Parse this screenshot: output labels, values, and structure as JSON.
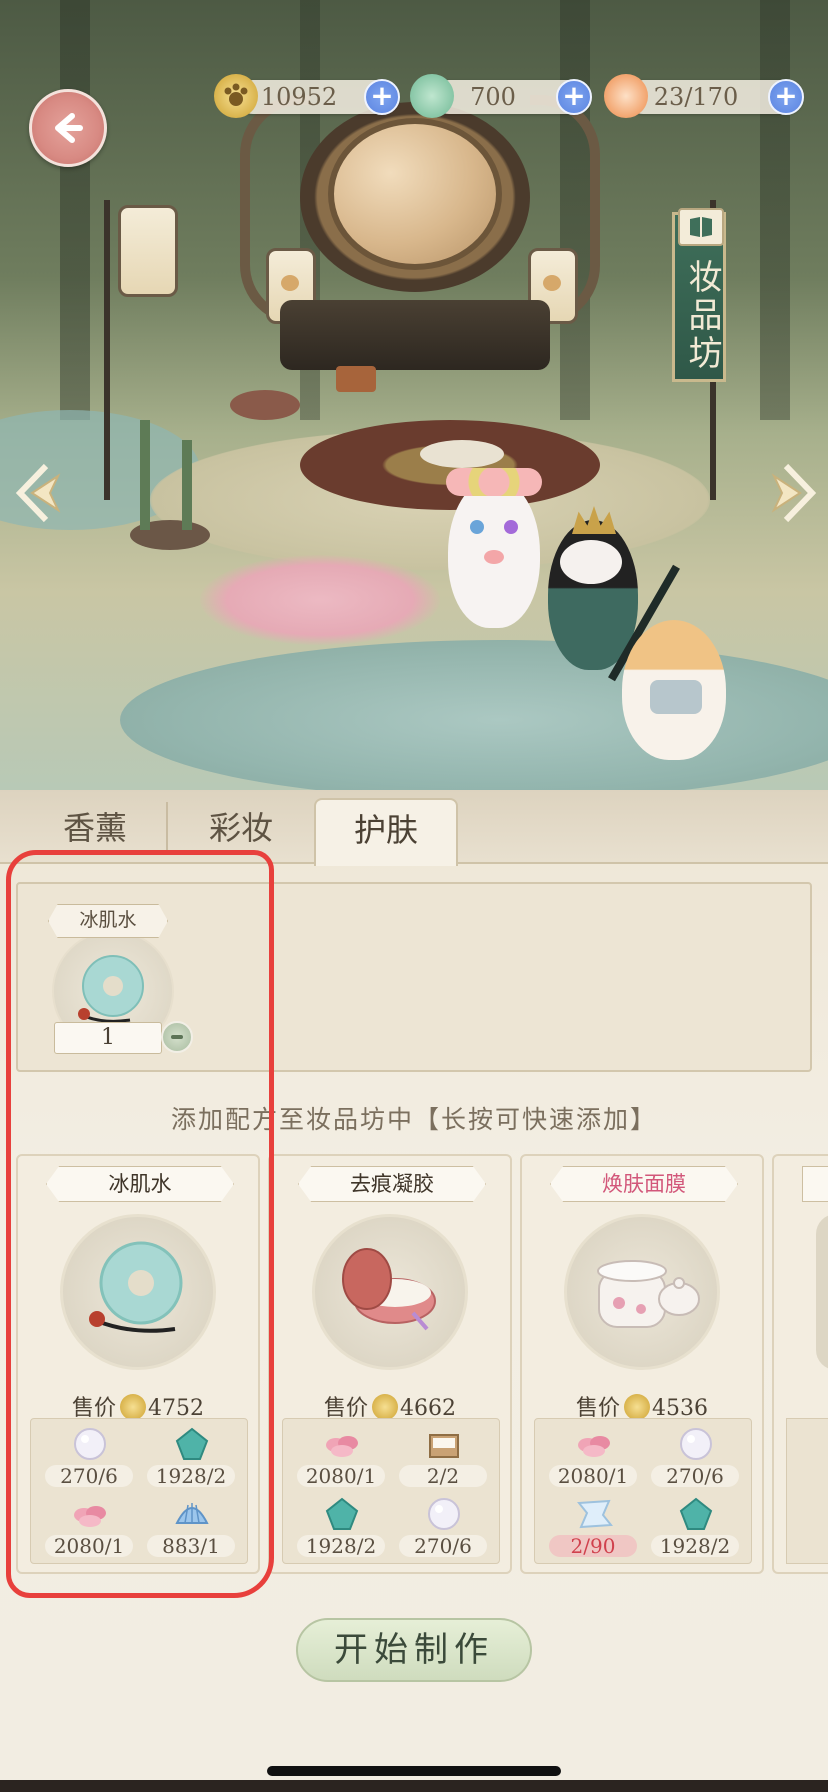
{
  "resources": [
    {
      "icon": "paw-coin-icon",
      "value": "10952"
    },
    {
      "icon": "jade-cicada-icon",
      "value": "700"
    },
    {
      "icon": "peach-bun-icon",
      "value": "23/170"
    }
  ],
  "sign": {
    "text": "妆品坊"
  },
  "tabs": [
    {
      "label": "香薰",
      "active": false
    },
    {
      "label": "彩妆",
      "active": false
    },
    {
      "label": "护肤",
      "active": true
    }
  ],
  "queue": {
    "item_name": "冰肌水",
    "quantity": "1"
  },
  "hint": "添加配方至妆品坊中【长按可快速添加】",
  "price_label": "售价",
  "recipes": [
    {
      "name": "冰肌水",
      "name_color": "#3f3529",
      "item_icon": "jade-ring-icon",
      "price": "4752",
      "materials": [
        {
          "icon": "pearl-icon",
          "count": "270/6",
          "insufficient": false
        },
        {
          "icon": "teal-gem-icon",
          "count": "1928/2",
          "insufficient": false
        },
        {
          "icon": "pink-petal-icon",
          "count": "2080/1",
          "insufficient": false
        },
        {
          "icon": "blue-shell-icon",
          "count": "883/1",
          "insufficient": false
        }
      ]
    },
    {
      "name": "去痕凝胶",
      "name_color": "#3f3529",
      "item_icon": "cream-jar-icon",
      "price": "4662",
      "materials": [
        {
          "icon": "pink-petal-icon",
          "count": "2080/1",
          "insufficient": false
        },
        {
          "icon": "powder-box-icon",
          "count": "2/2",
          "insufficient": false
        },
        {
          "icon": "teal-gem-icon",
          "count": "1928/2",
          "insufficient": false
        },
        {
          "icon": "pearl-icon",
          "count": "270/6",
          "insufficient": false
        }
      ]
    },
    {
      "name": "焕肤面膜",
      "name_color": "#d2577a",
      "item_icon": "porcelain-jar-icon",
      "price": "4536",
      "materials": [
        {
          "icon": "pink-petal-icon",
          "count": "2080/1",
          "insufficient": false
        },
        {
          "icon": "pearl-icon",
          "count": "270/6",
          "insufficient": false
        },
        {
          "icon": "silk-cloth-icon",
          "count": "2/90",
          "insufficient": true
        },
        {
          "icon": "teal-gem-icon",
          "count": "1928/2",
          "insufficient": false
        }
      ]
    }
  ],
  "start_button": "开始制作"
}
